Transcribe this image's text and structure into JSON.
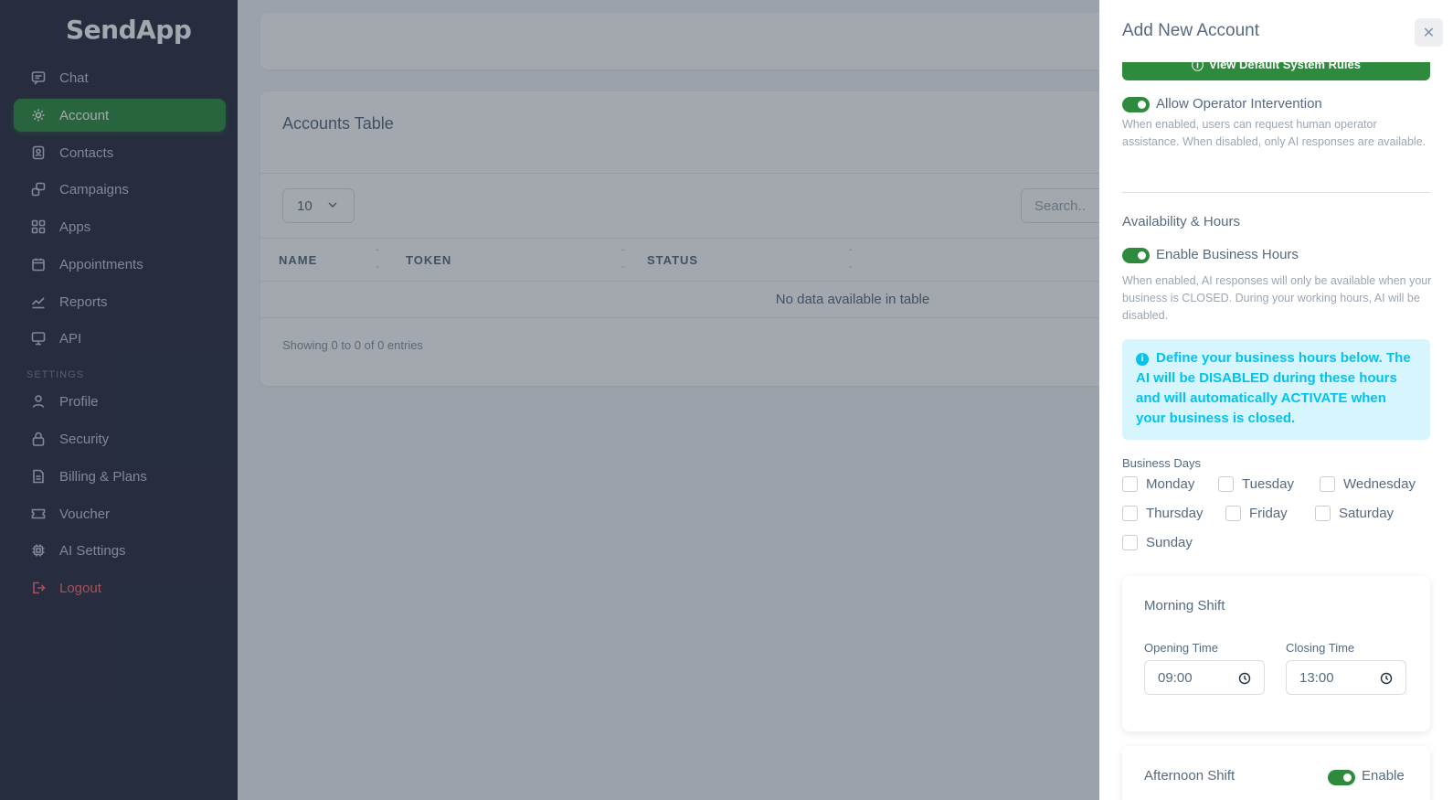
{
  "app": {
    "logo": "SendApp"
  },
  "sidebar": {
    "items": [
      {
        "label": "Chat",
        "icon": "chat-icon"
      },
      {
        "label": "Account",
        "icon": "gear-icon",
        "active": true
      },
      {
        "label": "Contacts",
        "icon": "contacts-icon"
      },
      {
        "label": "Campaigns",
        "icon": "campaigns-icon"
      },
      {
        "label": "Apps",
        "icon": "apps-grid-icon"
      },
      {
        "label": "Appointments",
        "icon": "calendar-icon"
      },
      {
        "label": "Reports",
        "icon": "chart-line-icon"
      },
      {
        "label": "API",
        "icon": "monitor-icon"
      }
    ],
    "settings_label": "SETTINGS",
    "settings_items": [
      {
        "label": "Profile",
        "icon": "user-icon"
      },
      {
        "label": "Security",
        "icon": "lock-icon"
      },
      {
        "label": "Billing & Plans",
        "icon": "file-icon"
      },
      {
        "label": "Voucher",
        "icon": "ticket-icon"
      },
      {
        "label": "AI Settings",
        "icon": "chip-icon"
      },
      {
        "label": "Logout",
        "icon": "logout-icon"
      }
    ]
  },
  "main": {
    "card_title": "Accounts Table",
    "page_size": "10",
    "search_placeholder": "Search..",
    "columns": [
      "NAME",
      "TOKEN",
      "STATUS"
    ],
    "empty_message": "No data available in table",
    "entries_info": "Showing 0 to 0 of 0 entries"
  },
  "panel": {
    "title": "Add New Account",
    "default_rules_button": "View Default System Rules",
    "operator": {
      "label": "Allow Operator Intervention",
      "enabled": true,
      "hint": "When enabled, users can request human operator assistance. When disabled, only AI responses are available."
    },
    "availability_title": "Availability & Hours",
    "business_hours": {
      "label": "Enable Business Hours",
      "enabled": true,
      "hint": "When enabled, AI responses will only be available when your business is CLOSED. During your working hours, AI will be disabled."
    },
    "info_text": "Define your business hours below. The AI will be DISABLED during these hours and will automatically ACTIVATE when your business is closed.",
    "business_days_label": "Business Days",
    "days": [
      "Monday",
      "Tuesday",
      "Wednesday",
      "Thursday",
      "Friday",
      "Saturday",
      "Sunday"
    ],
    "morning_shift": {
      "title": "Morning Shift",
      "opening_label": "Opening Time",
      "opening_value": "09:00",
      "closing_label": "Closing Time",
      "closing_value": "13:00"
    },
    "afternoon_shift": {
      "title": "Afternoon Shift",
      "enable_label": "Enable",
      "enabled": true
    }
  },
  "colors": {
    "accent": "#2e8b3d",
    "sidebar_bg": "#2b2c40",
    "info": "#03c3ec",
    "danger": "#ff6b6b"
  }
}
